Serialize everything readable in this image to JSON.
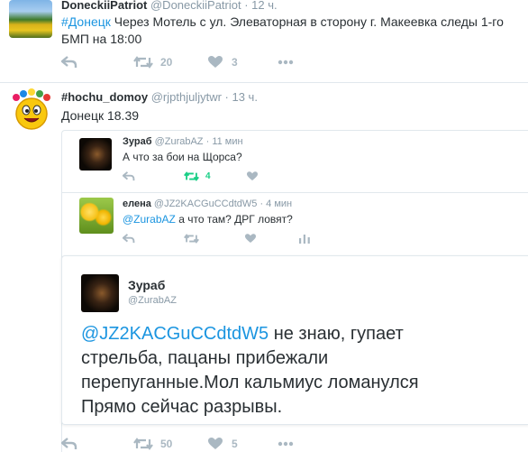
{
  "tweet1": {
    "name": "DoneckiiPatriot",
    "handle": "@DoneckiiPatriot",
    "time": "· 12 ч.",
    "hashtag": "#Донецк",
    "text": " Через Мотель с ул. Элеваторная в сторону г. Макеевка следы 1-го БМП на 18:00",
    "retweets": "20",
    "likes": "3"
  },
  "tweet2": {
    "name": "#hochu_domoy",
    "handle": "@rjpthjuljytwr",
    "time": "· 13 ч.",
    "text": "Донецк 18.39"
  },
  "reply1": {
    "name": "Зураб",
    "handle": "@ZurabAZ",
    "time": "· 11 мин",
    "text": "А что за бои на Щорса?",
    "retweets": "4"
  },
  "reply2": {
    "name": "елена",
    "handle": "@JZ2KACGuCCdtdW5",
    "time": "· 4 мин",
    "mention": "@ZurabAZ",
    "text": " а что там? ДРГ ловят?"
  },
  "focus": {
    "name": "Зураб",
    "handle": "@ZurabAZ",
    "mention": "@JZ2KACGuCCdtdW5",
    "text": " не знаю, гупает стрельба, пацаны прибежали перепуганные.Мол кальмиус ломанулся Прямо сейчас разрывы."
  },
  "bottom_bar": {
    "retweets": "50",
    "likes": "5"
  },
  "colors": {
    "link": "#1b95e0",
    "retweet_active": "#19cf86",
    "muted": "#aab8c2"
  },
  "icons": [
    "reply-icon",
    "retweet-icon",
    "heart-icon",
    "more-icon",
    "analytics-icon"
  ]
}
